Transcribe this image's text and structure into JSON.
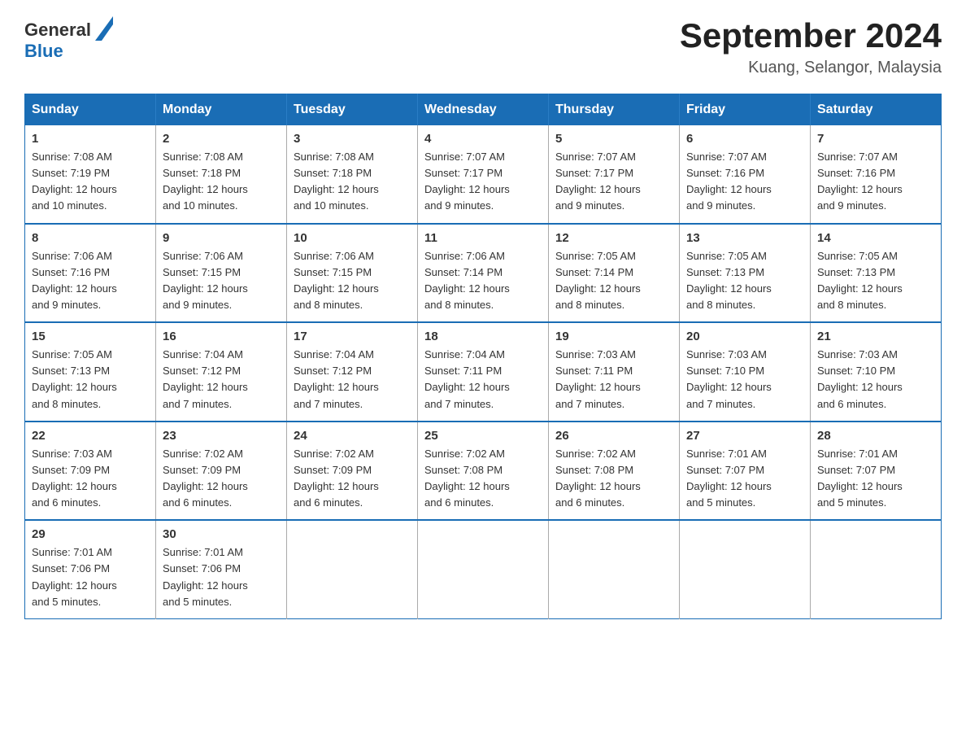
{
  "header": {
    "logo_general": "General",
    "logo_blue": "Blue",
    "title": "September 2024",
    "subtitle": "Kuang, Selangor, Malaysia"
  },
  "weekdays": [
    "Sunday",
    "Monday",
    "Tuesday",
    "Wednesday",
    "Thursday",
    "Friday",
    "Saturday"
  ],
  "weeks": [
    [
      {
        "day": "1",
        "sunrise": "7:08 AM",
        "sunset": "7:19 PM",
        "daylight": "12 hours and 10 minutes."
      },
      {
        "day": "2",
        "sunrise": "7:08 AM",
        "sunset": "7:18 PM",
        "daylight": "12 hours and 10 minutes."
      },
      {
        "day": "3",
        "sunrise": "7:08 AM",
        "sunset": "7:18 PM",
        "daylight": "12 hours and 10 minutes."
      },
      {
        "day": "4",
        "sunrise": "7:07 AM",
        "sunset": "7:17 PM",
        "daylight": "12 hours and 9 minutes."
      },
      {
        "day": "5",
        "sunrise": "7:07 AM",
        "sunset": "7:17 PM",
        "daylight": "12 hours and 9 minutes."
      },
      {
        "day": "6",
        "sunrise": "7:07 AM",
        "sunset": "7:16 PM",
        "daylight": "12 hours and 9 minutes."
      },
      {
        "day": "7",
        "sunrise": "7:07 AM",
        "sunset": "7:16 PM",
        "daylight": "12 hours and 9 minutes."
      }
    ],
    [
      {
        "day": "8",
        "sunrise": "7:06 AM",
        "sunset": "7:16 PM",
        "daylight": "12 hours and 9 minutes."
      },
      {
        "day": "9",
        "sunrise": "7:06 AM",
        "sunset": "7:15 PM",
        "daylight": "12 hours and 9 minutes."
      },
      {
        "day": "10",
        "sunrise": "7:06 AM",
        "sunset": "7:15 PM",
        "daylight": "12 hours and 8 minutes."
      },
      {
        "day": "11",
        "sunrise": "7:06 AM",
        "sunset": "7:14 PM",
        "daylight": "12 hours and 8 minutes."
      },
      {
        "day": "12",
        "sunrise": "7:05 AM",
        "sunset": "7:14 PM",
        "daylight": "12 hours and 8 minutes."
      },
      {
        "day": "13",
        "sunrise": "7:05 AM",
        "sunset": "7:13 PM",
        "daylight": "12 hours and 8 minutes."
      },
      {
        "day": "14",
        "sunrise": "7:05 AM",
        "sunset": "7:13 PM",
        "daylight": "12 hours and 8 minutes."
      }
    ],
    [
      {
        "day": "15",
        "sunrise": "7:05 AM",
        "sunset": "7:13 PM",
        "daylight": "12 hours and 8 minutes."
      },
      {
        "day": "16",
        "sunrise": "7:04 AM",
        "sunset": "7:12 PM",
        "daylight": "12 hours and 7 minutes."
      },
      {
        "day": "17",
        "sunrise": "7:04 AM",
        "sunset": "7:12 PM",
        "daylight": "12 hours and 7 minutes."
      },
      {
        "day": "18",
        "sunrise": "7:04 AM",
        "sunset": "7:11 PM",
        "daylight": "12 hours and 7 minutes."
      },
      {
        "day": "19",
        "sunrise": "7:03 AM",
        "sunset": "7:11 PM",
        "daylight": "12 hours and 7 minutes."
      },
      {
        "day": "20",
        "sunrise": "7:03 AM",
        "sunset": "7:10 PM",
        "daylight": "12 hours and 7 minutes."
      },
      {
        "day": "21",
        "sunrise": "7:03 AM",
        "sunset": "7:10 PM",
        "daylight": "12 hours and 6 minutes."
      }
    ],
    [
      {
        "day": "22",
        "sunrise": "7:03 AM",
        "sunset": "7:09 PM",
        "daylight": "12 hours and 6 minutes."
      },
      {
        "day": "23",
        "sunrise": "7:02 AM",
        "sunset": "7:09 PM",
        "daylight": "12 hours and 6 minutes."
      },
      {
        "day": "24",
        "sunrise": "7:02 AM",
        "sunset": "7:09 PM",
        "daylight": "12 hours and 6 minutes."
      },
      {
        "day": "25",
        "sunrise": "7:02 AM",
        "sunset": "7:08 PM",
        "daylight": "12 hours and 6 minutes."
      },
      {
        "day": "26",
        "sunrise": "7:02 AM",
        "sunset": "7:08 PM",
        "daylight": "12 hours and 6 minutes."
      },
      {
        "day": "27",
        "sunrise": "7:01 AM",
        "sunset": "7:07 PM",
        "daylight": "12 hours and 5 minutes."
      },
      {
        "day": "28",
        "sunrise": "7:01 AM",
        "sunset": "7:07 PM",
        "daylight": "12 hours and 5 minutes."
      }
    ],
    [
      {
        "day": "29",
        "sunrise": "7:01 AM",
        "sunset": "7:06 PM",
        "daylight": "12 hours and 5 minutes."
      },
      {
        "day": "30",
        "sunrise": "7:01 AM",
        "sunset": "7:06 PM",
        "daylight": "12 hours and 5 minutes."
      },
      null,
      null,
      null,
      null,
      null
    ]
  ],
  "labels": {
    "sunrise": "Sunrise:",
    "sunset": "Sunset:",
    "daylight": "Daylight:"
  }
}
